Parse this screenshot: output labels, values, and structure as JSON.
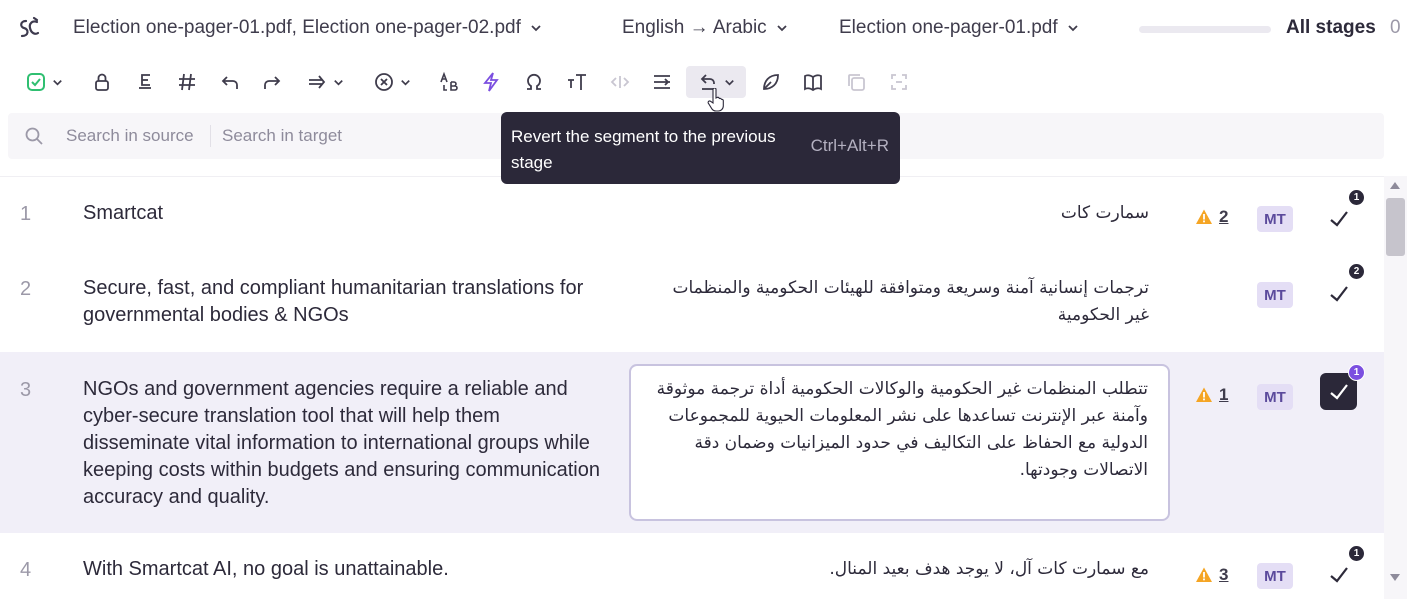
{
  "header": {
    "files": "Election one-pager-01.pdf, Election one-pager-02.pdf",
    "language_pair": "English → Arabic",
    "document": "Election one-pager-01.pdf",
    "stages": "All stages",
    "count": "0"
  },
  "search": {
    "source_placeholder": "Search in source",
    "target_placeholder": "Search in target"
  },
  "tooltip": {
    "text": "Revert the segment to the previous stage",
    "shortcut": "Ctrl+Alt+R"
  },
  "segments": [
    {
      "number": "1",
      "source": "Smartcat",
      "target": "سمارت كات",
      "warnings": "2",
      "mt": "MT",
      "stage": "1"
    },
    {
      "number": "2",
      "source": "Secure, fast, and compliant humanitarian translations for governmental bodies & NGOs",
      "target": "ترجمات إنسانية آمنة وسريعة ومتوافقة للهيئات الحكومية والمنظمات غير الحكومية",
      "warnings": "",
      "mt": "MT",
      "stage": "2"
    },
    {
      "number": "3",
      "source": "NGOs and government agencies require a reliable and cyber-secure translation tool that will help them disseminate vital information to international groups while keeping costs within budgets and ensuring communication accuracy and quality.",
      "target": "تتطلب المنظمات غير الحكومية والوكالات الحكومية أداة ترجمة موثوقة وآمنة عبر الإنترنت تساعدها على نشر المعلومات الحيوية للمجموعات الدولية مع الحفاظ على التكاليف في حدود الميزانيات وضمان دقة الاتصالات وجودتها.",
      "warnings": "1",
      "mt": "MT",
      "stage": "1"
    },
    {
      "number": "4",
      "source": "With Smartcat AI, no goal is unattainable.",
      "target": "مع سمارت كات آل، لا يوجد هدف بعيد المنال.",
      "warnings": "3",
      "mt": "MT",
      "stage": "1"
    }
  ],
  "colors": {
    "accent": "#7b4fe0",
    "dark": "#2b2839",
    "selected_row": "#f1eff8",
    "warning": "#f5a524",
    "confirm_green": "#2fbf71"
  },
  "icons": [
    "smartcat-logo-icon",
    "confirm-segment-icon",
    "lock-icon",
    "copy-source-icon",
    "tags-icon",
    "undo-icon",
    "redo-icon",
    "move-icon",
    "clear-icon",
    "case-icon",
    "lightning-icon",
    "omega-icon",
    "text-format-icon",
    "code-icon",
    "split-icon",
    "revert-stage-icon",
    "comment-icon",
    "glossary-icon",
    "duplicate-icon",
    "merge-icon",
    "search-icon",
    "warning-icon",
    "checkmark-icon"
  ]
}
